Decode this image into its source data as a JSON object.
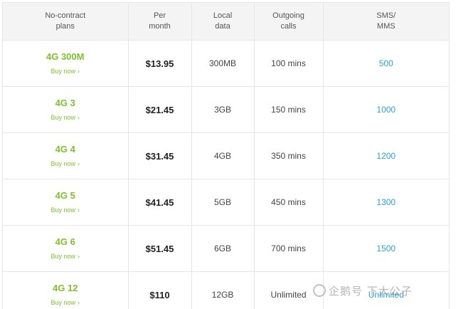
{
  "table": {
    "headers": [
      "No-contract\nplans",
      "Per\nmonth",
      "Local\ndata",
      "Outgoing\ncalls",
      "SMS/\nMMS"
    ],
    "buy_label": "Buy now",
    "buy_chevron": "›",
    "rows": [
      {
        "plan": "4G 300M",
        "price": "$13.95",
        "data": "300MB",
        "calls": "100 mins",
        "sms": "500"
      },
      {
        "plan": "4G 3",
        "price": "$21.45",
        "data": "3GB",
        "calls": "150 mins",
        "sms": "1000"
      },
      {
        "plan": "4G 4",
        "price": "$31.45",
        "data": "4GB",
        "calls": "350 mins",
        "sms": "1200"
      },
      {
        "plan": "4G 5",
        "price": "$41.45",
        "data": "5GB",
        "calls": "450 mins",
        "sms": "1300"
      },
      {
        "plan": "4G 6",
        "price": "$51.45",
        "data": "6GB",
        "calls": "700 mins",
        "sms": "1500"
      },
      {
        "plan": "4G 12",
        "price": "$110",
        "data": "12GB",
        "calls": "Unlimited",
        "sms": "Unlimited"
      }
    ]
  },
  "colors": {
    "plan_green": "#7dc12e",
    "sms_blue": "#2aa0d8",
    "header_bg": "#f4f4f4"
  },
  "watermark": {
    "text": "企鹅号 下大公子",
    "logo_icon": "penguin-logo-icon"
  }
}
